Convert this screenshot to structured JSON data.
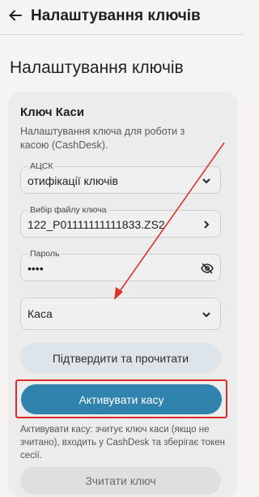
{
  "header": {
    "title": "Налаштування ключів"
  },
  "page": {
    "title": "Налаштування ключів"
  },
  "card": {
    "title": "Ключ Каси",
    "description": "Налаштування ключа для роботи з касою (CashDesk).",
    "fields": {
      "acsk": {
        "label": "АЦСК",
        "value": "отифікації ключів"
      },
      "key_file": {
        "label": "Вибір файлу ключа",
        "value": "122_P01111111111833.ZS2"
      },
      "password": {
        "label": "Пароль",
        "value": "••••"
      },
      "cash_desk": {
        "label": "",
        "value": "Каса"
      }
    },
    "confirm_button": "Підтвердити та прочитати",
    "activate_button": "Активувати касу",
    "help_text": "Активувати касу: зчитує ключ каси (якщо не зчитано), входить у CashDesk та зберігає токен сесії.",
    "bottom_button": "Зчитати ключ"
  },
  "colors": {
    "accent": "#2f83ad",
    "highlight": "#e02a2a"
  }
}
